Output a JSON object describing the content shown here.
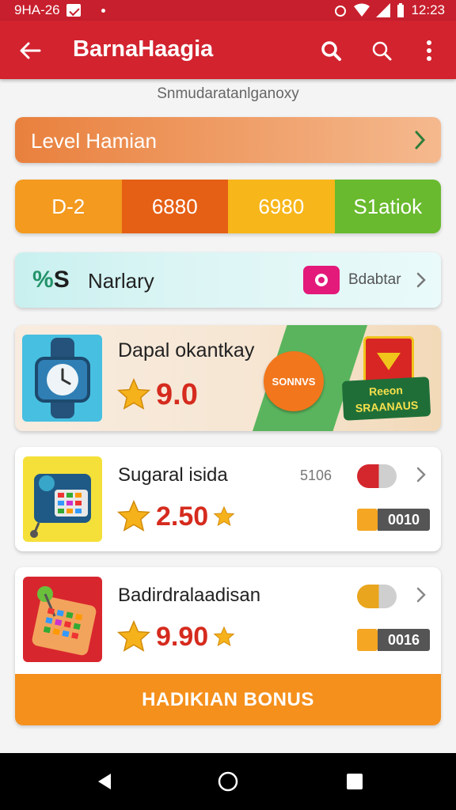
{
  "status": {
    "left_text": "9HA-26",
    "time": "12:23"
  },
  "header": {
    "title": "BarnaHaagia"
  },
  "subtitle": "Snmudaratanlganoxy",
  "level": {
    "label": "Level Hamian"
  },
  "stats": [
    {
      "value": "D-2",
      "color": "#f39a1f"
    },
    {
      "value": "6880",
      "color": "#e55f14"
    },
    {
      "value": "6980",
      "color": "#f7b619"
    },
    {
      "value": "S1atiok",
      "color": "#69ba2e"
    }
  ],
  "salary": {
    "prefix_pct": "%",
    "prefix_s": "S",
    "name": "Narlary",
    "badge_label": "Bdabtar"
  },
  "promo": {
    "title": "Dapal okantkay",
    "rating": "9.0",
    "circle_text": "SONNVS",
    "gift_text_top": "Reeon",
    "gift_text_bottom": "SRAANAUS"
  },
  "products": [
    {
      "name": "Sugaral isida",
      "meta": "5106",
      "rating": "2.50",
      "counter": "0010",
      "pill_color": "#d3262d"
    },
    {
      "name": "Badirdralaadisan",
      "meta": "",
      "rating": "9.90",
      "counter": "0016",
      "pill_color": "#e9a51d"
    }
  ],
  "bonus_button": "HADIKIAN BONUS",
  "colors": {
    "primary": "#d2232f",
    "accent_orange": "#f5901c",
    "star": "#f6b21b"
  }
}
